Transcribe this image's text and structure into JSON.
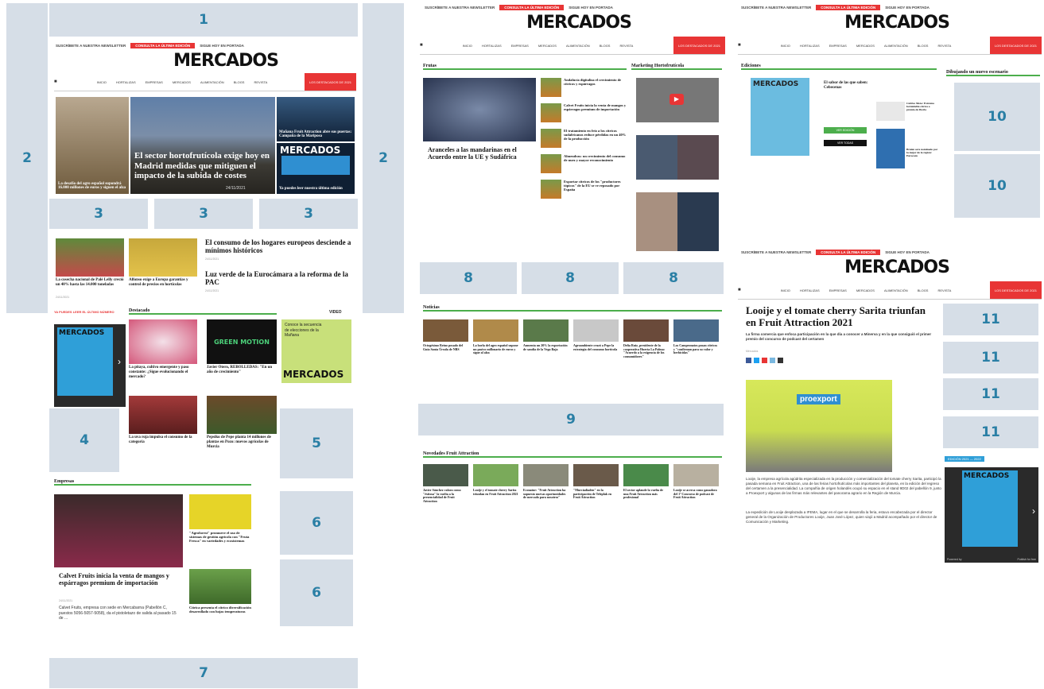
{
  "colors": {
    "accent_red": "#e83535",
    "section_green": "#4cae4c",
    "placeholder": "#d6dee7",
    "placeholder_text": "#2a7fa5"
  },
  "page1": {
    "topbar": {
      "subscribe": "SUSCRÍBETE A NUESTRA NEWSLETTER",
      "edition": "CONSULTA LA ÚLTIMA EDICIÓN",
      "kiosk": "SIGUE HOY EN PORTADA"
    },
    "logo": "MERCADOS",
    "nav": {
      "items": [
        "INICIO",
        "HORTALIZAS",
        "EMPRESAS",
        "MERCADOS",
        "ALIMENTACIÓN",
        "BLOGS",
        "REVISTA"
      ],
      "cta": "LOS DESTACADOS DE 2021"
    },
    "hero_left": "La desafío del agro español supondrá 16.000 millones de euros y siguen el alza",
    "hero_main": "El sector hortofrutícola exige hoy en Madrid medidas que mitiguen el impacto de la subida de costes",
    "hero_main_date": "24/11/2021",
    "hero_right_top": "Mañana Fruit Attraction abre sus puertas: Campaña de la Mariposa",
    "hero_right_bottom": "Ya puedes leer nuestra última edición",
    "news": [
      {
        "title": "La cosecha nacional de Palé Lelly creció un 40% hasta las 14.000 toneladas",
        "date": "24/11/2021"
      },
      {
        "title": "Alfonso exige a Europa garantías y control de precios en hortícolas",
        "date": "24/11/2021"
      },
      {
        "title": "El consumo de los hogares europeos desciende a mínimos históricos",
        "date": "24/11/2021"
      },
      {
        "title": "Luz verde de la Eurocámara a la reforma de la PAC",
        "date": "24/11/2021"
      }
    ],
    "sidebar_label": "YA PUEDES LEER EL ÚLTIMO NÚMERO",
    "destacado": "Destacado",
    "destacado_items": [
      {
        "title": "La pitaya, cultivo emergente y paso constante: ¿Sigue evolucionando el mercado?"
      },
      {
        "title": "Javier Otero, REBOLLEDAS: \"En un año de crecimiento\""
      },
      {
        "title": "La uva roja impulsa el consumo de la categoría"
      },
      {
        "title": "Pepsiko de Pepe planta 14 millones de plantas en Pozo: nuevos agrícolas de Murcia"
      }
    ],
    "green_motion": "GREEN MOTION",
    "video_label": "VIDEO",
    "video_card": "Conoce la secuencia de elecciones de la Mañana",
    "video_logo": "MERCADOS",
    "empresas": "Empresas",
    "empresa_main": "Calvet Fruits inicia la venta de mangos y espárragos premium de importación",
    "empresa_main_date": "24/11/2021",
    "empresa_main_body": "Calvet Fruits, empresa con sede en Mercabarna (Pabellón C, puestos 5056-5057-5058), da el pistoletazo de salida al pasado 15 de ...",
    "empresa_side": [
      {
        "title": "\"Agroforest\" promueve el uso de sistemas de gestión agrícola con \"Fruta Fresca\" en variedades y ecosistemas"
      },
      {
        "title": "Cítrica presenta el cítrico diversificación desarrollado con hojas temperaturas"
      }
    ],
    "magazine_logo": "MERCADOS"
  },
  "page2": {
    "topbar": {
      "subscribe": "SUSCRÍBETE A NUESTRA NEWSLETTER",
      "edition": "CONSULTA LA ÚLTIMA EDICIÓN",
      "kiosk": "SIGUE HOY EN PORTADA"
    },
    "logo": "MERCADOS",
    "nav": {
      "items": [
        "INICIO",
        "HORTALIZAS",
        "EMPRESAS",
        "MERCADOS",
        "ALIMENTACIÓN",
        "BLOGS",
        "REVISTA"
      ],
      "cta": "LOS DESTACADOS DE 2021"
    },
    "frutas": "Frutas",
    "frutas_main": "Aranceles a las mandarinas en el Acuerdo entre la UE y Sudáfrica",
    "frutas_list": [
      "Andalucía digitaliza el crecimiento de cítricos y espárragos",
      "Calvet Fruits inicia la venta de mangos y espárragos premium de importación",
      "El tratamiento en frío a los cítricos sudafricanos reduce pérdidas en un 40% de la producción",
      "Almendras: un crecimiento del consumo de nuez y mayor reconocimiento",
      "Exportar cítricos de los \"productores tópicos\" de la EU se ve reposado por España"
    ],
    "marketing": "Marketing Hortofrutícola",
    "noticias": "Noticias",
    "noticias_items": [
      "Octogésimo Reino posado del Guía Santa Úrsula de NBS",
      "La borla del agro español supone un pasivo millonario de euros y sigue al alza",
      "Aumenta un 20% la exportación de sandía de la Vega Baja",
      "Agroambiente cruzó a Pepe la estrategia del consumo hortícola",
      "Delia Ruiz, presidente de la cooperativa Huerta La Palma: \"Acuerdo a la exigencia de los consumidores\"",
      "Los Campeonatos posan cítricos y \"confirman para su valor y herbícidas\""
    ],
    "novedades": "Novedades Fruit Attraction",
    "novedades_items": [
      "Javier Sánchez valora como \"éxitosa\" la vuelta a la presencialidad de Fruit Attraction",
      "Looije y el tomate cherry Sarita triunfan en Fruit Attraction 2021",
      "Econatur: \"Fruit Attraction ha supuesto nuevas oportunidades de mercado para nosotros\"",
      "\"Murciadiaden\" en la participación de Teleplak en Fruit Attraction",
      "El sector aplaude la vuelta de una Fruit Attraction más profesional",
      "Looije se acerca como ganadora del 1º Concurso de podcast de Fruit Attraction"
    ]
  },
  "page3": {
    "topbar": {
      "subscribe": "SUSCRÍBETE A NUESTRA NEWSLETTER",
      "edition": "CONSULTA LA ÚLTIMA EDICIÓN",
      "kiosk": "SIGUE HOY EN PORTADA"
    },
    "logo": "MERCADOS",
    "nav": {
      "items": [
        "INICIO",
        "HORTALIZAS",
        "EMPRESAS",
        "MERCADOS",
        "ALIMENTACIÓN",
        "BLOGS",
        "REVISTA"
      ],
      "cta": "LOS DESTACADOS DE 2021"
    },
    "ediciones": "Ediciones",
    "dibujando": "Dibujando un nuevo escenario",
    "edition_title": "El sabor de las que saben: Cebecenas",
    "btn_green": "VER EDICIÓN",
    "btn_black": "VER TODAS",
    "side_item1": "Cultivo Meta: Extrema formidable cítrica a premio de Iberia",
    "side_item2": "Bralen sera nominado por la mejor de la región: Eurocam",
    "mag_logo": "MERCADOS"
  },
  "page4": {
    "topbar": {
      "subscribe": "SUSCRÍBETE A NUESTRA NEWSLETTER",
      "edition": "CONSULTA LA ÚLTIMA EDICIÓN",
      "kiosk": "SIGUE HOY EN PORTADA"
    },
    "logo": "MERCADOS",
    "nav": {
      "items": [
        "INICIO",
        "HORTALIZAS",
        "EMPRESAS",
        "MERCADOS",
        "ALIMENTACIÓN",
        "BLOGS",
        "REVISTA"
      ],
      "cta": "LOS DESTACADOS DE 2021"
    },
    "title": "Looije y el tomate cherry Sarita triunfan en Fruit Attraction 2021",
    "subtitle": "La firma comercia que enfoca participación en la que día a conocer a Minerva y en la que consiguió el primer premio del concurso de podcast del certamen",
    "author": "Mercados",
    "body1": "Looije, la empresa agrícola agúdrita especializada en la producción y comercialización del tomate cherry Sarita, participó la pasada semana en Fruit Attraction, una de las ferias hortofrutícolas más importantes del planeta, en la edición del regreso del certamen a la presencialidad. La compañía de origen holandés ocupó su espacio en el stand 9D02 del pabellón 9, junto a Proexport y algunas de las firmas más relevantes del panorama agrario en la Región de Murcia.",
    "body2": "La expedición de Looije desplazada a IFEMA, lugar en el que se desarrolla la feria, estuvo encabezada por el director general de la Organización de Productores Looije, Juan José López, quien viajó a Madrid acompañado por el director de Comunicación y Marketing.",
    "booth": "proexport",
    "ad_label": "EDICIÓN 2021 — 2022",
    "mag_logo": "MERCADOS",
    "ad_footer_left": "Powered by",
    "ad_footer_right": "Publish for free"
  },
  "slots": [
    "1",
    "2",
    "2",
    "3",
    "3",
    "3",
    "4",
    "5",
    "6",
    "6",
    "7",
    "8",
    "8",
    "8",
    "9",
    "10",
    "10",
    "11",
    "11",
    "11",
    "11"
  ]
}
